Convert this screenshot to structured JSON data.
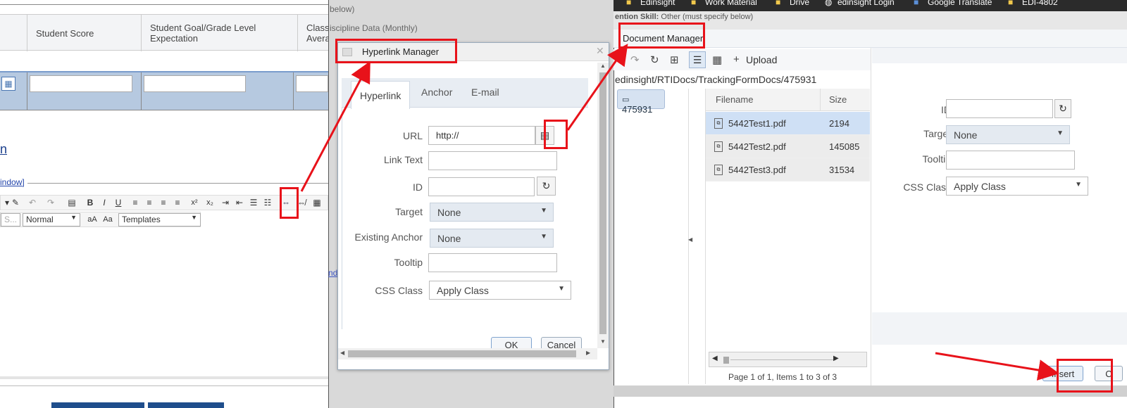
{
  "left_panel": {
    "columns": [
      "Student Score",
      "Student Goal/Grade Level Expectation",
      "Class Average"
    ],
    "column_display": [
      "Student Score",
      "Student Goal/Grade Level\nExpectation",
      "Class\nAvera"
    ],
    "link_fragment": "n",
    "window_link": "indow]",
    "format_select": "Normal",
    "style_select_partial": "S...",
    "templates_select": "Templates",
    "toolbar_glyphs": [
      "B",
      "I",
      "U",
      "x²",
      "x₂",
      "aA",
      "Aa"
    ]
  },
  "mid_panel": {
    "bg_text1": "below)",
    "bg_text2": "iscipline Data (Monthly)",
    "bg_link": "nd"
  },
  "hyperlink_manager": {
    "title": "Hyperlink Manager",
    "tabs": [
      "Hyperlink",
      "Anchor",
      "E-mail"
    ],
    "active_tab": "Hyperlink",
    "fields": {
      "url_label": "URL",
      "url_value": "http://",
      "link_text_label": "Link Text",
      "id_label": "ID",
      "target_label": "Target",
      "target_value": "None",
      "existing_anchor_label": "Existing Anchor",
      "existing_anchor_value": "None",
      "tooltip_label": "Tooltip",
      "css_class_label": "CSS Class",
      "css_class_value": "Apply Class"
    },
    "ok_label": "OK",
    "cancel_label": "Cancel"
  },
  "bookmarks": [
    "Edinsight",
    "Work Material",
    "Drive",
    "edinsight Login",
    "Google Translate",
    "EDI-4802"
  ],
  "document_manager": {
    "title": "Document Manager",
    "behind_text": "ention Skill: Other (must specify below)",
    "behind_label": "ention Skill:",
    "behind_value": "Other (must specify below)",
    "upload_label": "Upload",
    "path": "edinsight/RTIDocs/TrackingFormDocs/475931",
    "tree_folder": "475931",
    "columns": [
      "Filename",
      "Size"
    ],
    "files": [
      {
        "name": "5442Test1.pdf",
        "size": "2194"
      },
      {
        "name": "5442Test2.pdf",
        "size": "145085"
      },
      {
        "name": "5442Test3.pdf",
        "size": "31534"
      }
    ],
    "pager_text": "Page 1 of 1, Items 1 to 3 of 3",
    "props": {
      "id_label": "ID",
      "target_label": "Target",
      "target_value": "None",
      "tooltip_label": "Tooltip",
      "css_class_label": "CSS Class",
      "css_class_value": "Apply Class"
    },
    "insert_label": "Insert",
    "cancel_partial": "C"
  },
  "colors": {
    "annotation_red": "#e8121a",
    "selection_blue": "#b6c9e0",
    "row_selected": "#cfe0f5"
  }
}
